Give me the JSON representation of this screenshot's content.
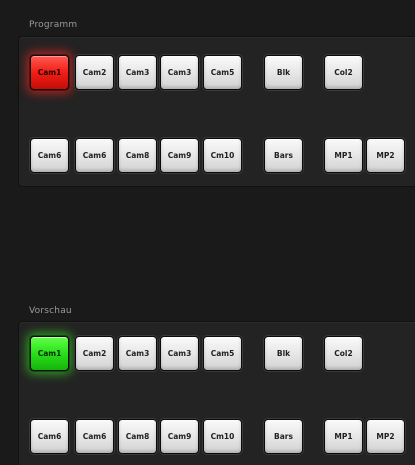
{
  "program": {
    "title": "Programm",
    "row1": [
      {
        "label": "Cam1",
        "state": "program-live"
      },
      {
        "label": "Cam2",
        "state": "off"
      },
      {
        "label": "Cam3",
        "state": "off"
      },
      {
        "label": "Cam3",
        "state": "off"
      },
      {
        "label": "Cam5",
        "state": "off"
      },
      {
        "label": "Blk",
        "state": "off"
      },
      {
        "label": "Col2",
        "state": "off"
      }
    ],
    "row2": [
      {
        "label": "Cam6",
        "state": "off"
      },
      {
        "label": "Cam6",
        "state": "off"
      },
      {
        "label": "Cam8",
        "state": "off"
      },
      {
        "label": "Cam9",
        "state": "off"
      },
      {
        "label": "Cm10",
        "state": "off"
      },
      {
        "label": "Bars",
        "state": "off"
      },
      {
        "label": "MP1",
        "state": "off"
      },
      {
        "label": "MP2",
        "state": "off"
      }
    ]
  },
  "preview": {
    "title": "Vorschau",
    "row1": [
      {
        "label": "Cam1",
        "state": "preview-live"
      },
      {
        "label": "Cam2",
        "state": "off"
      },
      {
        "label": "Cam3",
        "state": "off"
      },
      {
        "label": "Cam3",
        "state": "off"
      },
      {
        "label": "Cam5",
        "state": "off"
      },
      {
        "label": "Blk",
        "state": "off"
      },
      {
        "label": "Col2",
        "state": "off"
      }
    ],
    "row2": [
      {
        "label": "Cam6",
        "state": "off"
      },
      {
        "label": "Cam6",
        "state": "off"
      },
      {
        "label": "Cam8",
        "state": "off"
      },
      {
        "label": "Cam9",
        "state": "off"
      },
      {
        "label": "Cm10",
        "state": "off"
      },
      {
        "label": "Bars",
        "state": "off"
      },
      {
        "label": "MP1",
        "state": "off"
      },
      {
        "label": "MP2",
        "state": "off"
      }
    ]
  },
  "colors": {
    "program_live": "#f01e16",
    "preview_live": "#28e01a",
    "button_off": "#e9e9e9",
    "background": "#1a1a1a"
  }
}
